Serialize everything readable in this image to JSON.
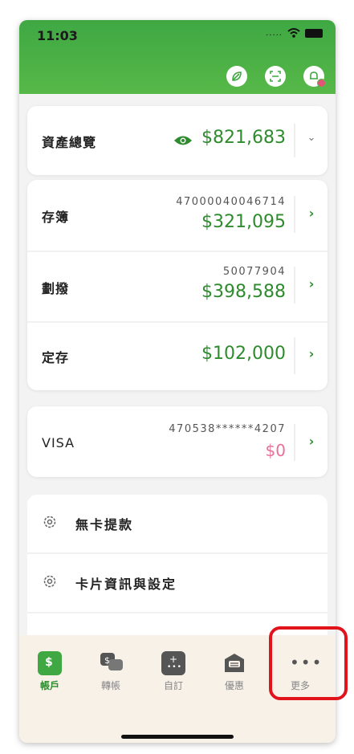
{
  "status_bar": {
    "time": "11:03",
    "signal": "....."
  },
  "header": {
    "icons": [
      "leaf-icon",
      "scan-icon",
      "bell-icon"
    ]
  },
  "overview": {
    "label": "資產總覽",
    "amount": "$821,683",
    "icon": "eye-icon"
  },
  "accounts": [
    {
      "label": "存簿",
      "number": "47000040046714",
      "amount": "$321,095"
    },
    {
      "label": "劃撥",
      "number": "50077904",
      "amount": "$398,588"
    },
    {
      "label": "定存",
      "number": "",
      "amount": "$102,000"
    }
  ],
  "visa": {
    "label": "VISA",
    "number": "470538******4207",
    "amount": "$0"
  },
  "menu": [
    {
      "label": "無卡提款",
      "icon": "gear-icon"
    },
    {
      "label": "卡片資訊與設定",
      "icon": "gear-icon"
    }
  ],
  "tabbar": [
    {
      "label": "帳戶",
      "icon": "account-icon",
      "active": true
    },
    {
      "label": "轉帳",
      "icon": "transfer-icon",
      "active": false
    },
    {
      "label": "自訂",
      "icon": "custom-icon",
      "active": false
    },
    {
      "label": "優惠",
      "icon": "offers-icon",
      "active": false
    },
    {
      "label": "更多",
      "icon": "more-icon",
      "active": false
    }
  ],
  "colors": {
    "brand_green": "#3fa843",
    "amount_green": "#2e8b2e",
    "visa_pink": "#e8709a",
    "highlight_red": "#e1141b"
  }
}
